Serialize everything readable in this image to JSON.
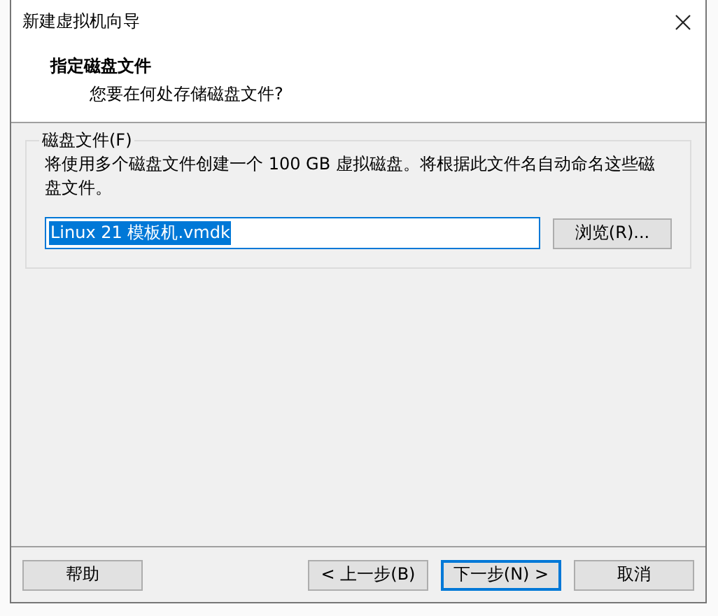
{
  "window": {
    "title": "新建虚拟机向导"
  },
  "header": {
    "title": "指定磁盘文件",
    "subtitle": "您要在何处存储磁盘文件?"
  },
  "group": {
    "label": "磁盘文件(F)",
    "description": "将使用多个磁盘文件创建一个 100 GB 虚拟磁盘。将根据此文件名自动命名这些磁盘文件。",
    "file_field": {
      "value": "Linux 21 模板机.vmdk",
      "text_selected": true
    },
    "browse_button": "浏览(R)..."
  },
  "buttons": [
    {
      "label": "帮助",
      "default": false
    },
    {
      "label": "< 上一步(B)",
      "default": false
    },
    {
      "label": "下一步(N) >",
      "default": true
    },
    {
      "label": "取消",
      "default": false
    }
  ]
}
